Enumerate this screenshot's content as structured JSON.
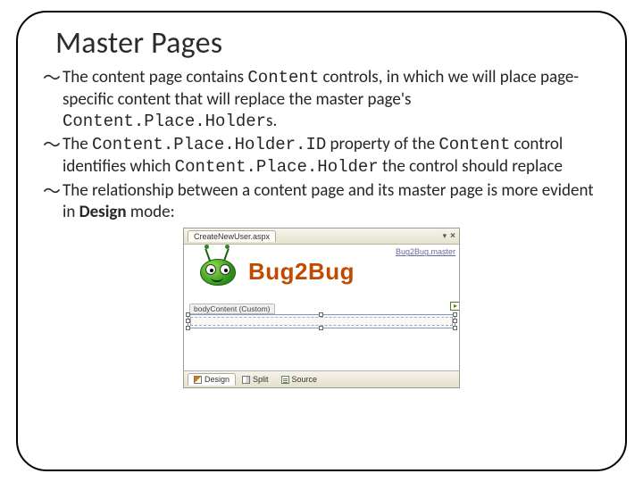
{
  "title": "Master Pages",
  "bullets": [
    {
      "before": "The content page contains ",
      "code1": "Content",
      "mid1": " controls, in which we will place page-specific content that will replace the master page's ",
      "code2": "Content.Place.Holder",
      "after": "s."
    },
    {
      "before": "The ",
      "code1": "Content.Place.Holder.ID",
      "mid1": " property of the ",
      "code2": "Content",
      "mid2": " control identifies which ",
      "code3": "Content.Place.Holder",
      "after": " the control should replace"
    },
    {
      "before": "The relationship between a content page and its master page is more evident in ",
      "bold": "Design",
      "after": " mode:"
    }
  ],
  "vs": {
    "tab": "CreateNewUser.aspx",
    "masterLabel": "Bug2Bug.master",
    "logoText": "Bug2Bug",
    "contentPlaceholder": "bodyContent (Custom)",
    "modes": {
      "design": "Design",
      "split": "Split",
      "source": "Source"
    }
  }
}
